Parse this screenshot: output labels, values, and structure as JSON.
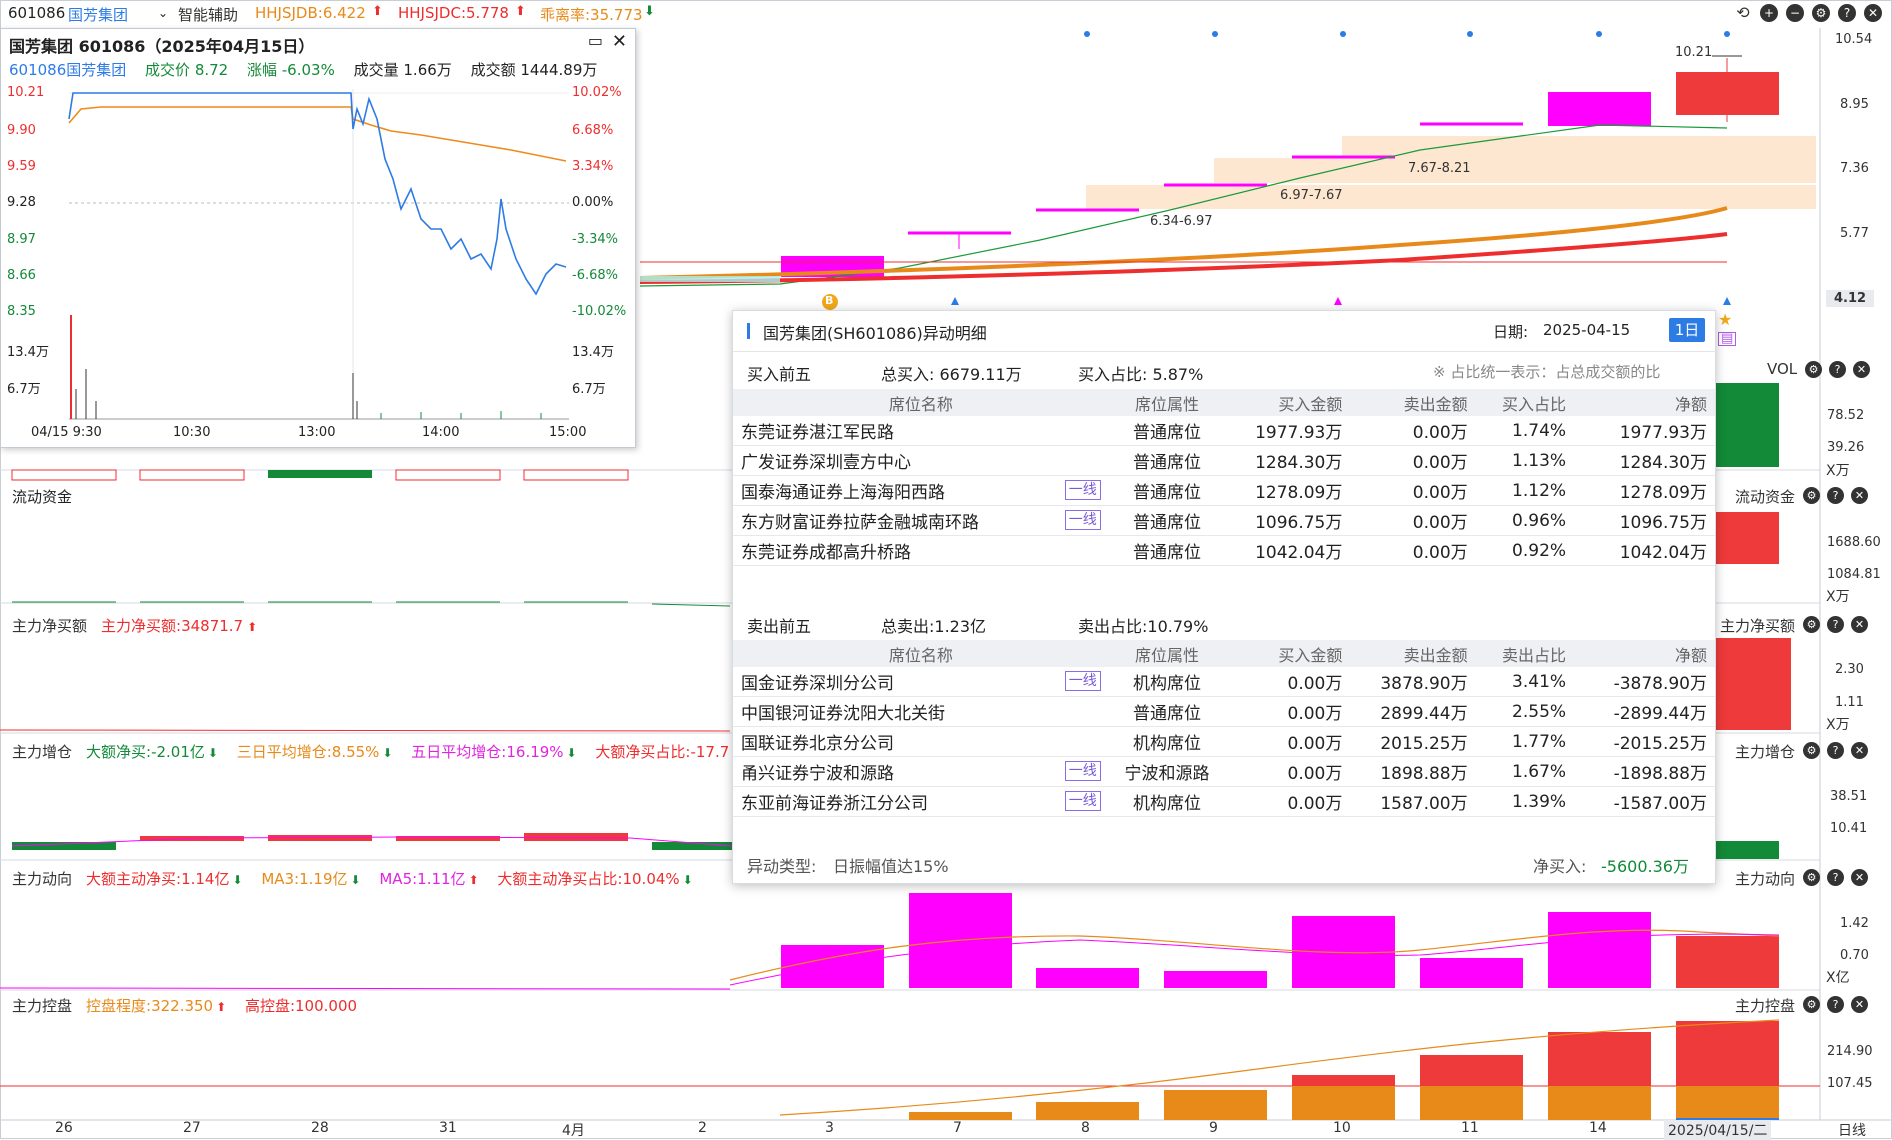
{
  "topbar": {
    "code": "601086",
    "name": "国芳集团",
    "assist": "智能辅助",
    "hhjsjdb": "HHJSJDB:6.422",
    "hhjsjdc": "HHJSJDC:5.778",
    "deviation": "乖离率:35.773"
  },
  "main_chart": {
    "price_labels": [
      "10.54",
      "8.95",
      "7.36",
      "5.77",
      "4.12"
    ],
    "current_price": "4.12",
    "high_label": "10.21",
    "zone_labels": [
      "6.34-6.97",
      "6.97-7.67",
      "7.67-8.21"
    ],
    "marker_b": "B"
  },
  "intraday": {
    "title": "国芳集团 601086（2025年04月15日）",
    "code_name": "601086国芳集团",
    "price_label": "成交价 8.72",
    "change_label": "涨幅 -6.03%",
    "volume_label": "成交量 1.66万",
    "amount_label": "成交额 1444.89万",
    "left_prices": [
      "10.21",
      "9.90",
      "9.59",
      "9.28",
      "8.97",
      "8.66",
      "8.35"
    ],
    "right_pcts": [
      "10.02%",
      "6.68%",
      "3.34%",
      "0.00%",
      "-3.34%",
      "-6.68%",
      "-10.02%"
    ],
    "vol_labels": [
      "13.4万",
      "6.7万"
    ],
    "times": [
      "04/15 9:30",
      "10:30",
      "13:00",
      "14:00",
      "15:00"
    ]
  },
  "panels": {
    "vol": {
      "name": "VOL",
      "values": [
        "78.52",
        "39.26"
      ],
      "unit": "X万"
    },
    "liquidity": {
      "name": "流动资金",
      "values": [
        "1688.60",
        "1084.81"
      ],
      "unit": "X万"
    },
    "net_buy": {
      "name": "主力净买额",
      "label": "主力净买额:34871.7",
      "values": [
        "2.30",
        "1.11"
      ],
      "unit": "X万"
    },
    "position": {
      "name": "主力增仓",
      "items": [
        "大额净买:-2.01亿",
        "三日平均增仓:8.55%",
        "五日平均增仓:16.19%",
        "大额净买占比:-17.7"
      ],
      "values": [
        "38.51",
        "10.41"
      ]
    },
    "direction": {
      "name": "主力动向",
      "items": [
        "大额主动净买:1.14亿",
        "MA3:1.19亿",
        "MA5:1.11亿",
        "大额主动净买占比:10.04%"
      ],
      "values": [
        "1.42",
        "0.70"
      ],
      "unit": "X亿"
    },
    "control": {
      "name": "主力控盘",
      "items": [
        "控盘程度:322.350",
        "高控盘:100.000"
      ],
      "values": [
        "214.90",
        "107.45"
      ]
    }
  },
  "x_axis": [
    "26",
    "27",
    "28",
    "31",
    "4月",
    "2",
    "3",
    "7",
    "8",
    "9",
    "10",
    "11",
    "14",
    "2025/04/15/二",
    "日线"
  ],
  "detail": {
    "title": "国芳集团(SH601086)异动明细",
    "date_label": "日期:",
    "date": "2025-04-15",
    "period_button": "1日",
    "buy": {
      "section": "买入前五",
      "total": "总买入: 6679.11万",
      "ratio": "买入占比: 5.87%",
      "note": "※ 占比统一表示：占总成交额的比",
      "headers": [
        "席位名称",
        "席位属性",
        "买入金额",
        "卖出金额",
        "买入占比",
        "净额"
      ],
      "rows": [
        {
          "name": "东莞证券湛江军民路",
          "badge": "",
          "attr": "普通席位",
          "buy": "1977.93万",
          "sell": "0.00万",
          "pct": "1.74%",
          "net": "1977.93万"
        },
        {
          "name": "广发证券深圳壹方中心",
          "badge": "",
          "attr": "普通席位",
          "buy": "1284.30万",
          "sell": "0.00万",
          "pct": "1.13%",
          "net": "1284.30万"
        },
        {
          "name": "国泰海通证券上海海阳西路",
          "badge": "一线",
          "attr": "普通席位",
          "buy": "1278.09万",
          "sell": "0.00万",
          "pct": "1.12%",
          "net": "1278.09万"
        },
        {
          "name": "东方财富证券拉萨金融城南环路",
          "badge": "一线",
          "attr": "普通席位",
          "buy": "1096.75万",
          "sell": "0.00万",
          "pct": "0.96%",
          "net": "1096.75万"
        },
        {
          "name": "东莞证券成都高升桥路",
          "badge": "",
          "attr": "普通席位",
          "buy": "1042.04万",
          "sell": "0.00万",
          "pct": "0.92%",
          "net": "1042.04万"
        }
      ]
    },
    "sell": {
      "section": "卖出前五",
      "total": "总卖出:1.23亿",
      "ratio": "卖出占比:10.79%",
      "headers": [
        "席位名称",
        "席位属性",
        "买入金额",
        "卖出金额",
        "卖出占比",
        "净额"
      ],
      "rows": [
        {
          "name": "国金证券深圳分公司",
          "badge": "一线",
          "attr": "机构席位",
          "buy": "0.00万",
          "sell": "3878.90万",
          "pct": "3.41%",
          "net": "-3878.90万"
        },
        {
          "name": "中国银河证券沈阳大北关街",
          "badge": "",
          "attr": "普通席位",
          "buy": "0.00万",
          "sell": "2899.44万",
          "pct": "2.55%",
          "net": "-2899.44万"
        },
        {
          "name": "国联证券北京分公司",
          "badge": "",
          "attr": "机构席位",
          "buy": "0.00万",
          "sell": "2015.25万",
          "pct": "1.77%",
          "net": "-2015.25万"
        },
        {
          "name": "甬兴证券宁波和源路",
          "badge": "一线",
          "attr": "宁波和源路",
          "buy": "0.00万",
          "sell": "1898.88万",
          "pct": "1.67%",
          "net": "-1898.88万"
        },
        {
          "name": "东亚前海证券浙江分公司",
          "badge": "一线",
          "attr": "机构席位",
          "buy": "0.00万",
          "sell": "1587.00万",
          "pct": "1.39%",
          "net": "-1587.00万"
        }
      ]
    },
    "footer": {
      "type_label": "异动类型:",
      "type": "日振幅值达15%",
      "net_label": "净买入:",
      "net": "-5600.36万"
    }
  },
  "colors": {
    "up": "#ee2e2e",
    "down": "#1a8a3a",
    "magenta": "#ff00ff",
    "orange": "#e88a1a",
    "blue": "#2d7be5",
    "zone": "#fde3c9"
  }
}
